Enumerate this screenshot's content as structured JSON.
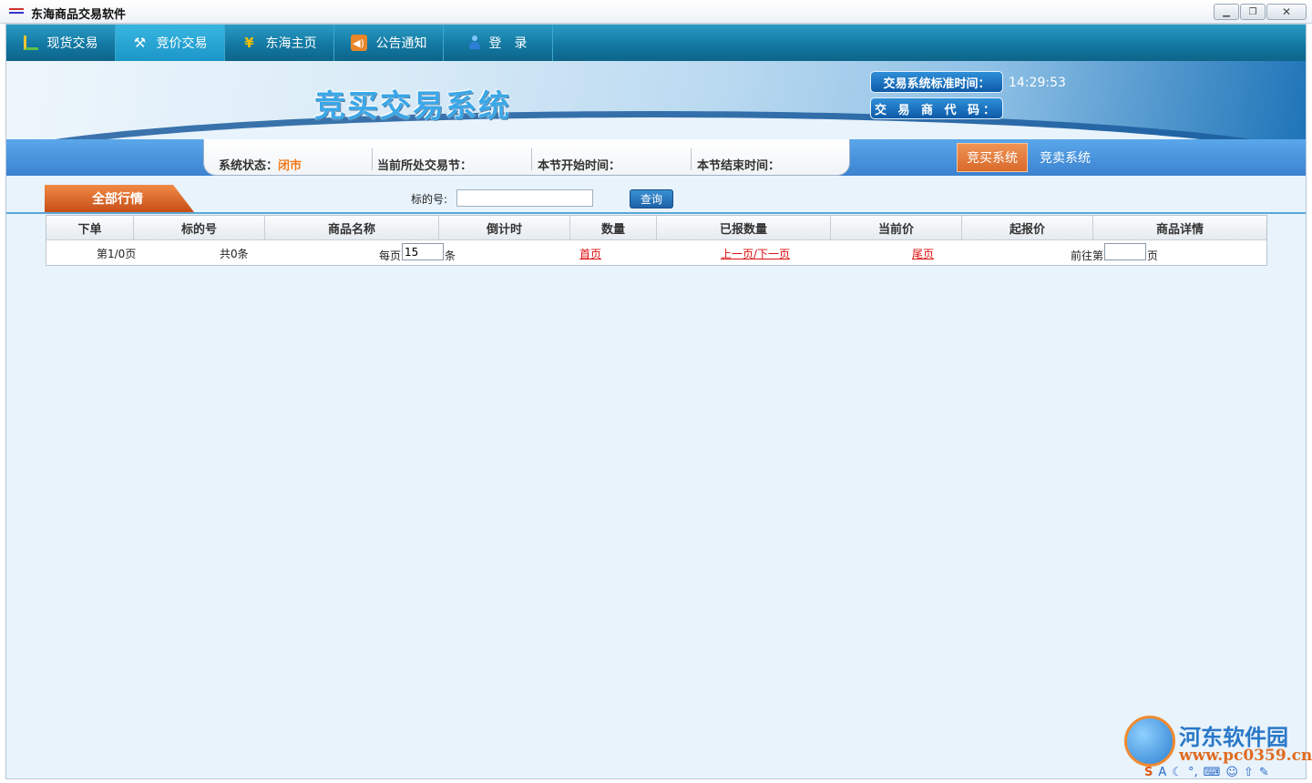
{
  "window": {
    "title": "东海商品交易软件"
  },
  "nav": {
    "items": [
      {
        "label": "现货交易",
        "icon": "chart-icon"
      },
      {
        "label": "竞价交易",
        "icon": "gavel-icon",
        "active": true
      },
      {
        "label": "东海主页",
        "icon": "yen-icon"
      },
      {
        "label": "公告通知",
        "icon": "speaker-icon"
      },
      {
        "label": "登　录",
        "icon": "user-icon"
      }
    ]
  },
  "banner": {
    "title": "竞买交易系统",
    "time_label": "交易系统标准时间：",
    "time_value": "14:29:53",
    "trader_label": "交 易 商 代 码："
  },
  "status": {
    "system_state_label": "系统状态：",
    "system_state_value": "闭市",
    "current_section_label": "当前所处交易节：",
    "start_time_label": "本节开始时间：",
    "end_time_label": "本节结束时间："
  },
  "subtabs": [
    {
      "label": "竞买系统",
      "active": true
    },
    {
      "label": "竞卖系统",
      "active": false
    }
  ],
  "section": {
    "tab_label": "全部行情"
  },
  "filter": {
    "label": "标的号:",
    "input_value": "",
    "button_label": "查询"
  },
  "table": {
    "columns": [
      "下单",
      "标的号",
      "商品名称",
      "倒计时",
      "数量",
      "已报数量",
      "当前价",
      "起报价",
      "商品详情"
    ]
  },
  "pager": {
    "page_info": "第1/0页",
    "total": "共0条",
    "per_page_label": "每页",
    "per_page_value": "15",
    "per_page_unit": "条",
    "first": "首页",
    "prev_next": "上一页/下一页",
    "last": "尾页",
    "goto_label": "前往第",
    "goto_value": "",
    "goto_unit": "页"
  },
  "watermark": {
    "name": "河东软件园",
    "url": "www.pc0359.cn"
  },
  "colors": {
    "nav": "#1379a3",
    "accent_orange": "#d96a2a",
    "status_value": "#f07a1a",
    "link_red": "#dd1111"
  }
}
